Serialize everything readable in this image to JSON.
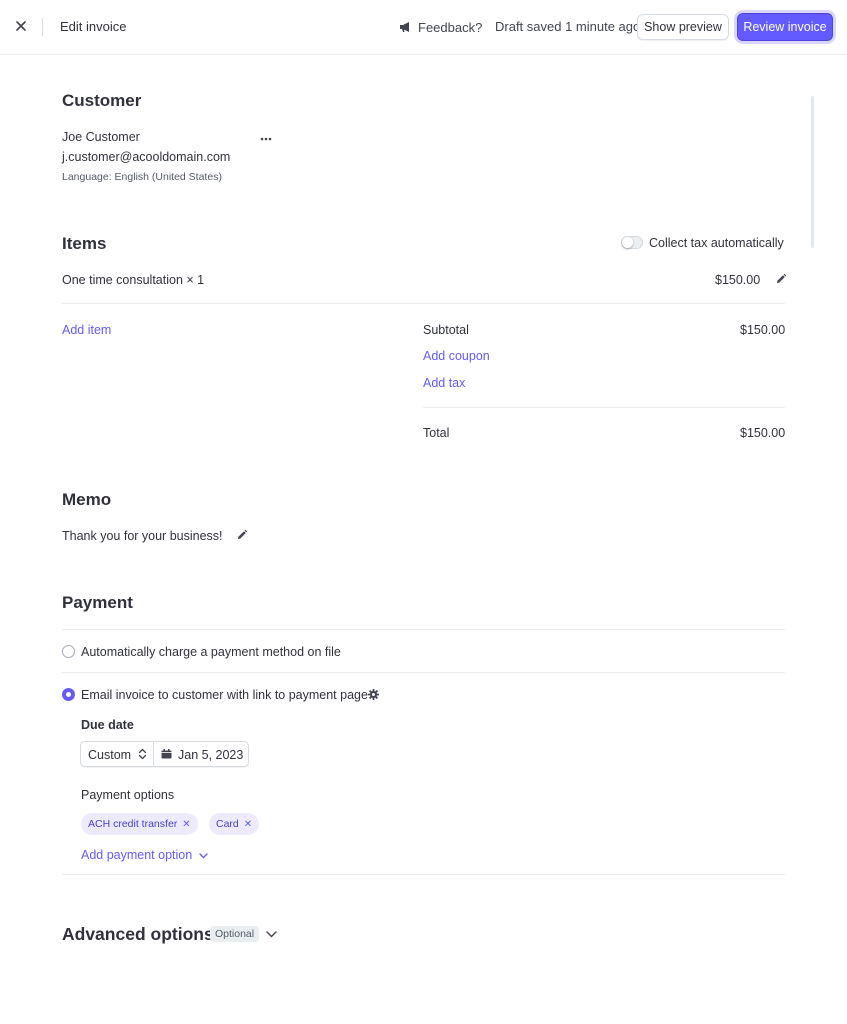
{
  "topbar": {
    "title": "Edit invoice",
    "feedback_label": "Feedback?",
    "draft_status": "Draft saved 1 minute ago",
    "preview_label": "Show preview",
    "review_label": "Review invoice"
  },
  "customer": {
    "heading": "Customer",
    "name": "Joe Customer",
    "email": "j.customer@acooldomain.com",
    "language": "Language: English (United States)"
  },
  "items": {
    "heading": "Items",
    "tax_toggle_label": "Collect tax automatically",
    "tax_toggle_on": false,
    "line_items": [
      {
        "description": "One time consultation × 1",
        "amount": "$150.00"
      }
    ],
    "add_item": "Add item",
    "subtotal_label": "Subtotal",
    "subtotal_value": "$150.00",
    "add_coupon": "Add coupon",
    "add_tax": "Add tax",
    "total_label": "Total",
    "total_value": "$150.00"
  },
  "memo": {
    "heading": "Memo",
    "text": "Thank you for your business!"
  },
  "payment": {
    "heading": "Payment",
    "option_auto": "Automatically charge a payment method on file",
    "option_email": "Email invoice to customer with link to payment page",
    "selected": "email",
    "due_date_label": "Due date",
    "due_mode": "Custom",
    "due_date": "Jan 5, 2023",
    "payment_options_label": "Payment options",
    "payment_options": [
      "ACH credit transfer",
      "Card"
    ],
    "add_payment_option": "Add payment option"
  },
  "advanced": {
    "heading": "Advanced options",
    "badge": "Optional"
  },
  "colors": {
    "accent": "#635bff",
    "text": "#30313d",
    "chip_bg": "#edeafd"
  }
}
